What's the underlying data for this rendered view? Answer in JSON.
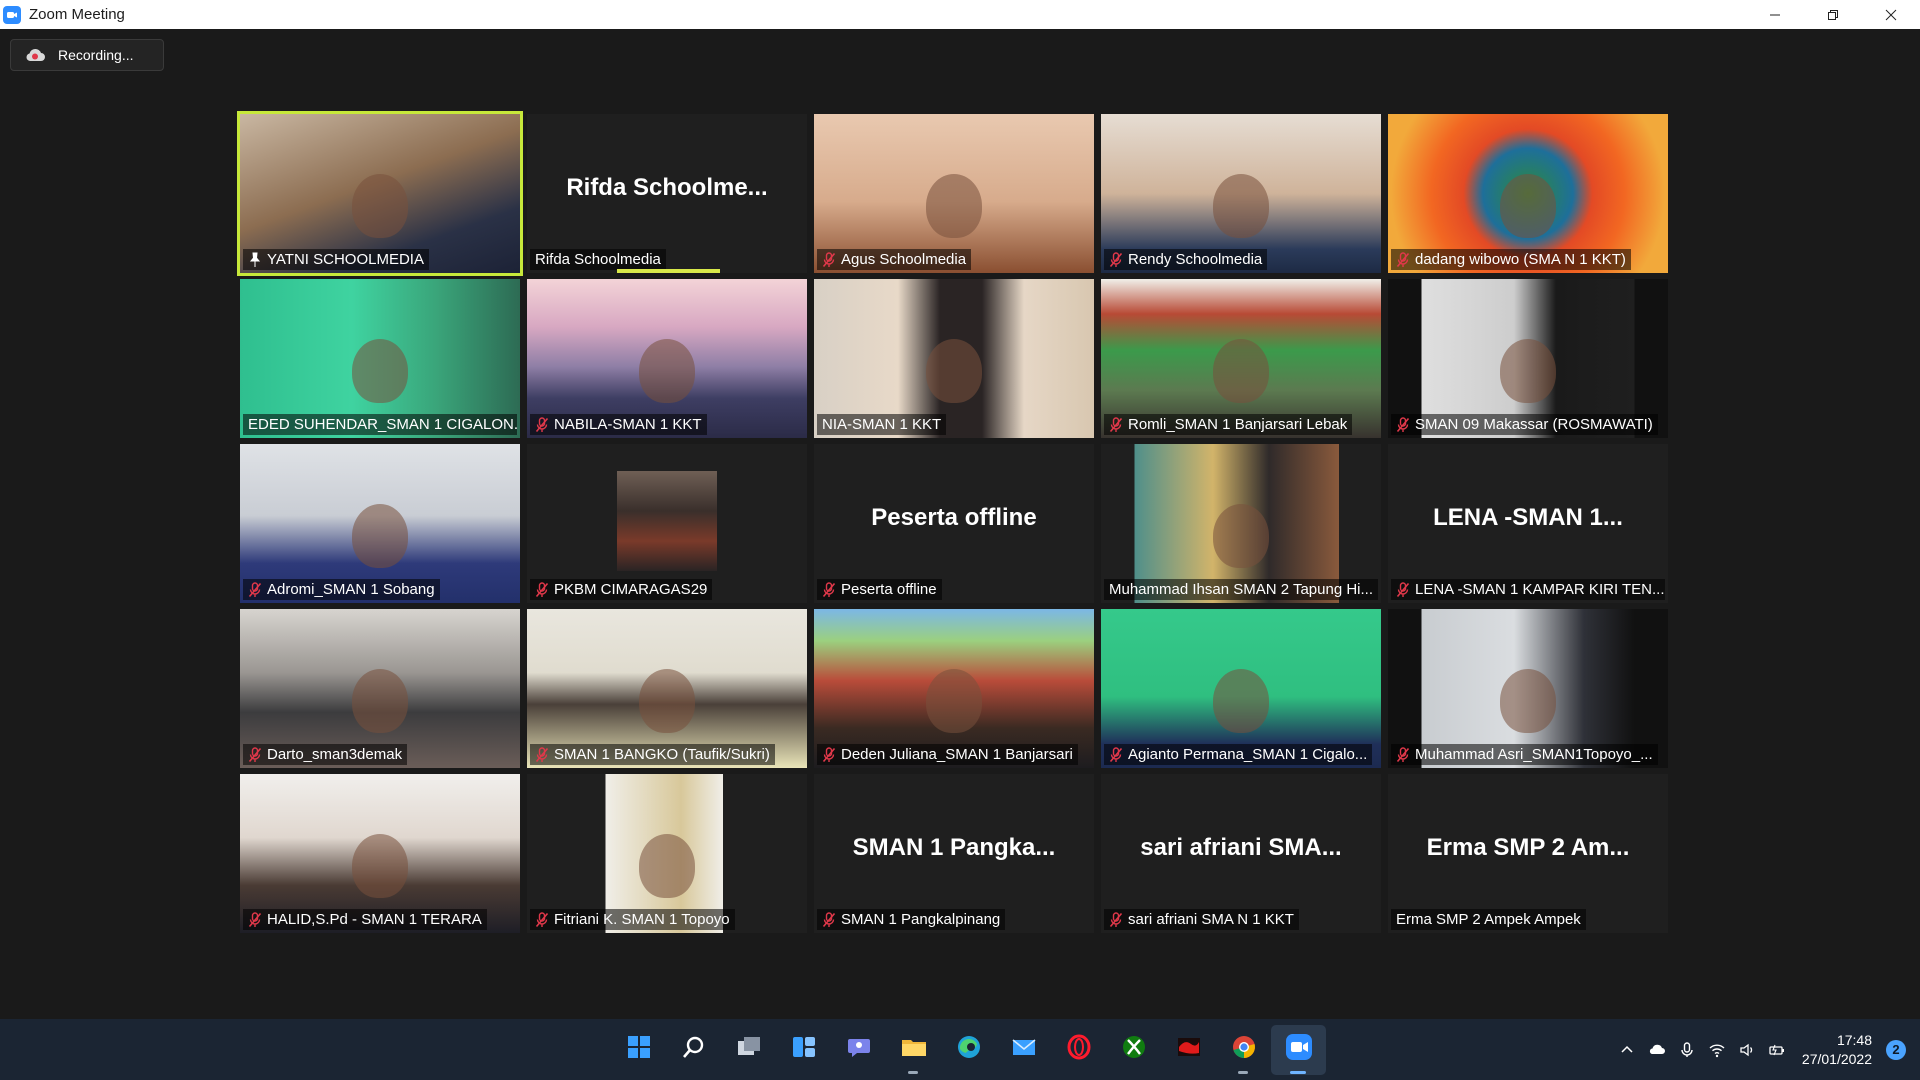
{
  "window": {
    "title": "Zoom Meeting"
  },
  "recording": {
    "label": "Recording..."
  },
  "colors": {
    "active_speaker": "#c7e83a",
    "muted_icon": "#e0384a",
    "zoom_blue": "#2d8cff"
  },
  "participants": [
    {
      "name": "YATNI SCHOOLMEDIA",
      "muted": false,
      "pinned": true,
      "video": "on",
      "active": true
    },
    {
      "name": "Rifda Schoolmedia",
      "muted": false,
      "video": "off",
      "display_name": "Rifda  Schoolme...",
      "speaking": true
    },
    {
      "name": "Agus Schoolmedia",
      "muted": true,
      "video": "on"
    },
    {
      "name": "Rendy Schoolmedia",
      "muted": true,
      "video": "on"
    },
    {
      "name": "dadang wibowo (SMA N 1 KKT)",
      "muted": true,
      "video": "on"
    },
    {
      "name": "EDED SUHENDAR_SMAN 1 CIGALON...",
      "muted": false,
      "video": "on"
    },
    {
      "name": "NABILA-SMAN 1 KKT",
      "muted": true,
      "video": "on"
    },
    {
      "name": "NIA-SMAN 1 KKT",
      "muted": false,
      "video": "on"
    },
    {
      "name": "Romli_SMAN 1 Banjarsari Lebak",
      "muted": true,
      "video": "on"
    },
    {
      "name": "SMAN 09 Makassar (ROSMAWATI)",
      "muted": true,
      "video": "on"
    },
    {
      "name": "Adromi_SMAN 1 Sobang",
      "muted": true,
      "video": "on"
    },
    {
      "name": "PKBM CIMARAGAS29",
      "muted": true,
      "video": "avatar"
    },
    {
      "name": "Peserta offline",
      "muted": true,
      "video": "off",
      "display_name": "Peserta offline"
    },
    {
      "name": "Muhammad Ihsan SMAN 2 Tapung Hi...",
      "muted": false,
      "video": "on"
    },
    {
      "name": "LENA -SMAN 1 KAMPAR KIRI TEN...",
      "muted": true,
      "video": "off",
      "display_name": "LENA  -SMAN  1..."
    },
    {
      "name": "Darto_sman3demak",
      "muted": true,
      "video": "on"
    },
    {
      "name": "SMAN 1 BANGKO (Taufik/Sukri)",
      "muted": true,
      "video": "on"
    },
    {
      "name": "Deden Juliana_SMAN 1 Banjarsari",
      "muted": true,
      "video": "on"
    },
    {
      "name": "Agianto Permana_SMAN 1 Cigalo...",
      "muted": true,
      "video": "on"
    },
    {
      "name": "Muhammad Asri_SMAN1Topoyo_...",
      "muted": true,
      "video": "on"
    },
    {
      "name": "HALID,S.Pd - SMAN 1 TERARA",
      "muted": true,
      "video": "on"
    },
    {
      "name": "Fitriani K. SMAN 1 Topoyo",
      "muted": true,
      "video": "on"
    },
    {
      "name": "SMAN 1 Pangkalpinang",
      "muted": true,
      "video": "off",
      "display_name": "SMAN  1  Pangka..."
    },
    {
      "name": "sari afriani SMA N 1 KKT",
      "muted": true,
      "video": "off",
      "display_name": "sari  afriani  SMA..."
    },
    {
      "name": "Erma SMP 2 Ampek Ampek",
      "muted": false,
      "video": "off",
      "display_name": "Erma  SMP  2  Am..."
    }
  ],
  "taskbar": {
    "apps": [
      "start-icon",
      "search-icon",
      "task-view-icon",
      "widgets-icon",
      "chat-icon",
      "file-explorer-icon",
      "edge-icon",
      "mail-icon",
      "opera-icon",
      "xbox-icon",
      "app-red-icon",
      "chrome-icon",
      "zoom-icon"
    ],
    "time": "17:48",
    "date": "27/01/2022",
    "notifications": "2"
  }
}
